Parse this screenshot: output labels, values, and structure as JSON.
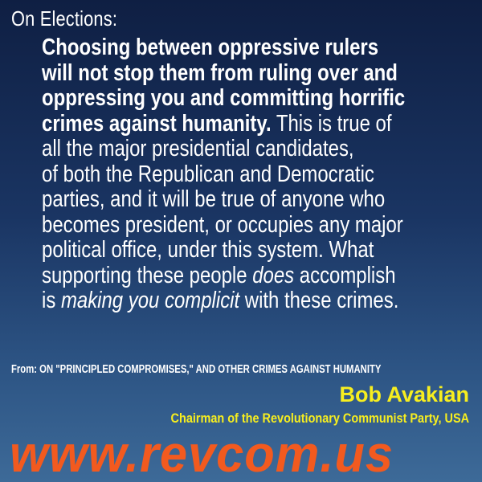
{
  "heading": "On Elections:",
  "quote": {
    "bold_lines": [
      "Choosing between oppressive rulers",
      "will not stop them from ruling over and",
      "oppressing you and committing horrific"
    ],
    "line4_bold": "crimes against humanity.",
    "line4_rest": " This is true of",
    "lines_plain": [
      "all the major presidential candidates,",
      "of both the Republican and Democratic",
      "parties, and it will be true of anyone who",
      "becomes president, or occupies any major",
      "political office, under this system. What"
    ],
    "line10_a": "supporting these people ",
    "line10_italic": "does",
    "line10_b": " accomplish",
    "line11_a": "is ",
    "line11_italic": "making you complicit",
    "line11_b": " with these crimes."
  },
  "source": "From: ON \"PRINCIPLED COMPROMISES,\" AND OTHER CRIMES AGAINST HUMANITY",
  "author": {
    "name": "Bob Avakian",
    "title": "Chairman of the Revolutionary Communist Party, USA"
  },
  "website": "www.revcom.us",
  "colors": {
    "background_top": "#0f1f43",
    "background_bottom": "#3d6a98",
    "text": "#ffffff",
    "author": "#f7ee1f",
    "website": "#f25a1f"
  }
}
